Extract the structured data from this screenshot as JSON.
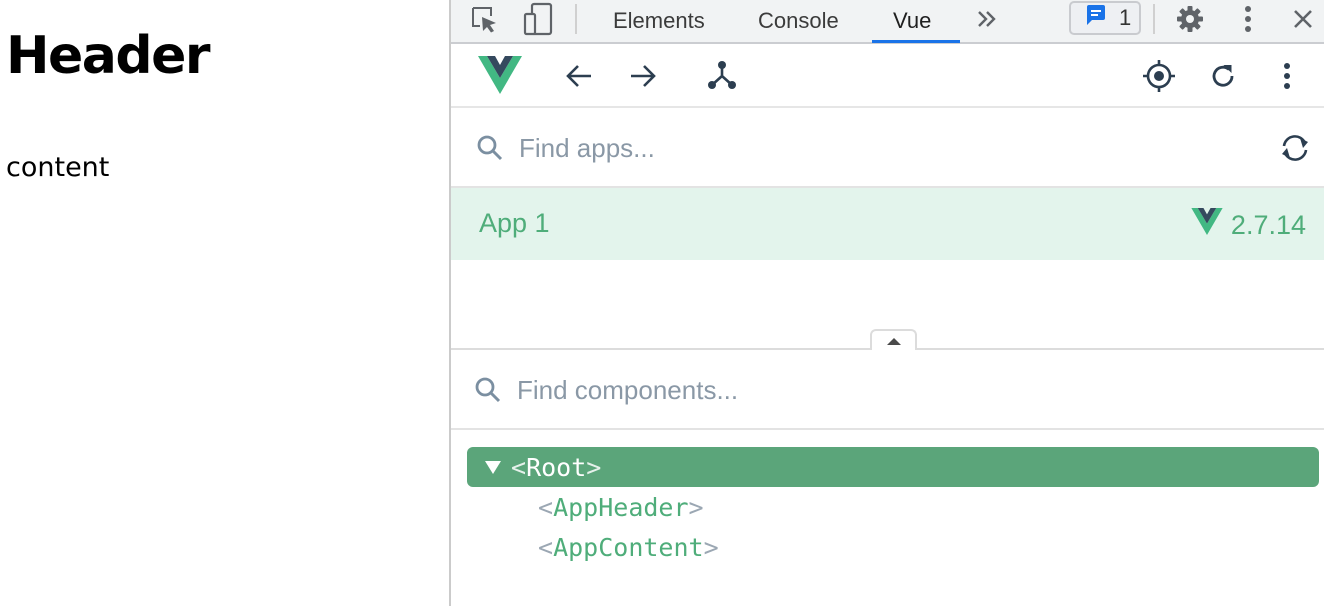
{
  "page": {
    "header": "Header",
    "content": "content"
  },
  "devtools": {
    "tabs": [
      {
        "label": "Elements",
        "active": false
      },
      {
        "label": "Console",
        "active": false
      },
      {
        "label": "Vue",
        "active": true
      }
    ],
    "overflow_icon": "chevron-double-right-icon",
    "messages_count": "1",
    "accent_color": "#1a73e8",
    "icons": [
      "inspect-icon",
      "device-toggle-icon",
      "gear-icon",
      "more-vert-icon",
      "close-icon"
    ]
  },
  "vue": {
    "brand_color": "#42b883",
    "toolbar_icons": [
      "vue-logo-icon",
      "arrow-left-icon",
      "arrow-right-icon",
      "component-tree-icon",
      "target-icon",
      "refresh-icon",
      "more-vert-icon"
    ],
    "apps_search": {
      "placeholder": "Find apps..."
    },
    "apps": [
      {
        "name": "App 1",
        "version": "2.7.14"
      }
    ],
    "components_search": {
      "placeholder": "Find components..."
    },
    "tree": {
      "open": "<",
      "close": ">",
      "root": "Root",
      "children": [
        "AppHeader",
        "AppContent"
      ]
    }
  }
}
